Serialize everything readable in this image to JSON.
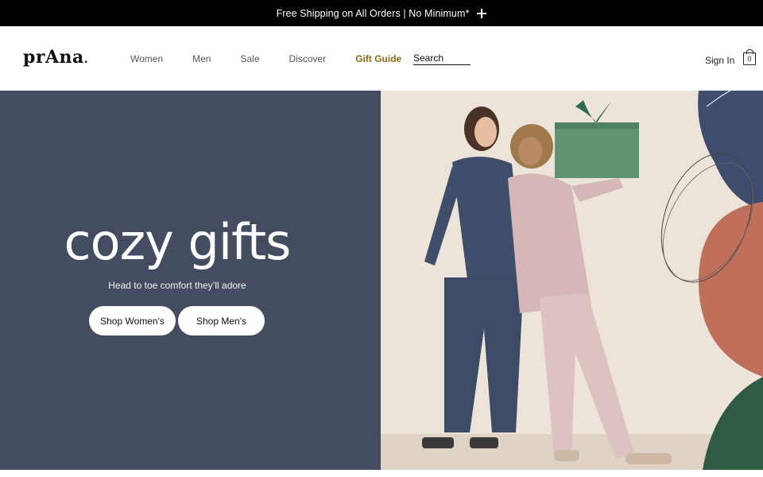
{
  "promo": {
    "text": "Free Shipping on All Orders | No Minimum*",
    "expand_icon": "plus-icon"
  },
  "header": {
    "logo": "prAna",
    "nav": [
      "Women",
      "Men",
      "Sale",
      "Discover",
      "Gift Guide"
    ],
    "search_label": "Search",
    "sign_in": "Sign In",
    "bag_count": "0",
    "bag_icon": "shopping-bag-icon"
  },
  "hero": {
    "title": "cozy gifts",
    "subtitle": "Head to toe comfort they’ll adore",
    "buttons": [
      "Shop Women's",
      "Shop Men's"
    ],
    "image": "couple-with-gift-photo"
  },
  "colors": {
    "promo_bg": "#000000",
    "hero_bg": "#434c60",
    "gift_guide_accent": "#8a6a1a",
    "photo_bg": "#ece4d9",
    "gift_box": "#5e9270"
  }
}
